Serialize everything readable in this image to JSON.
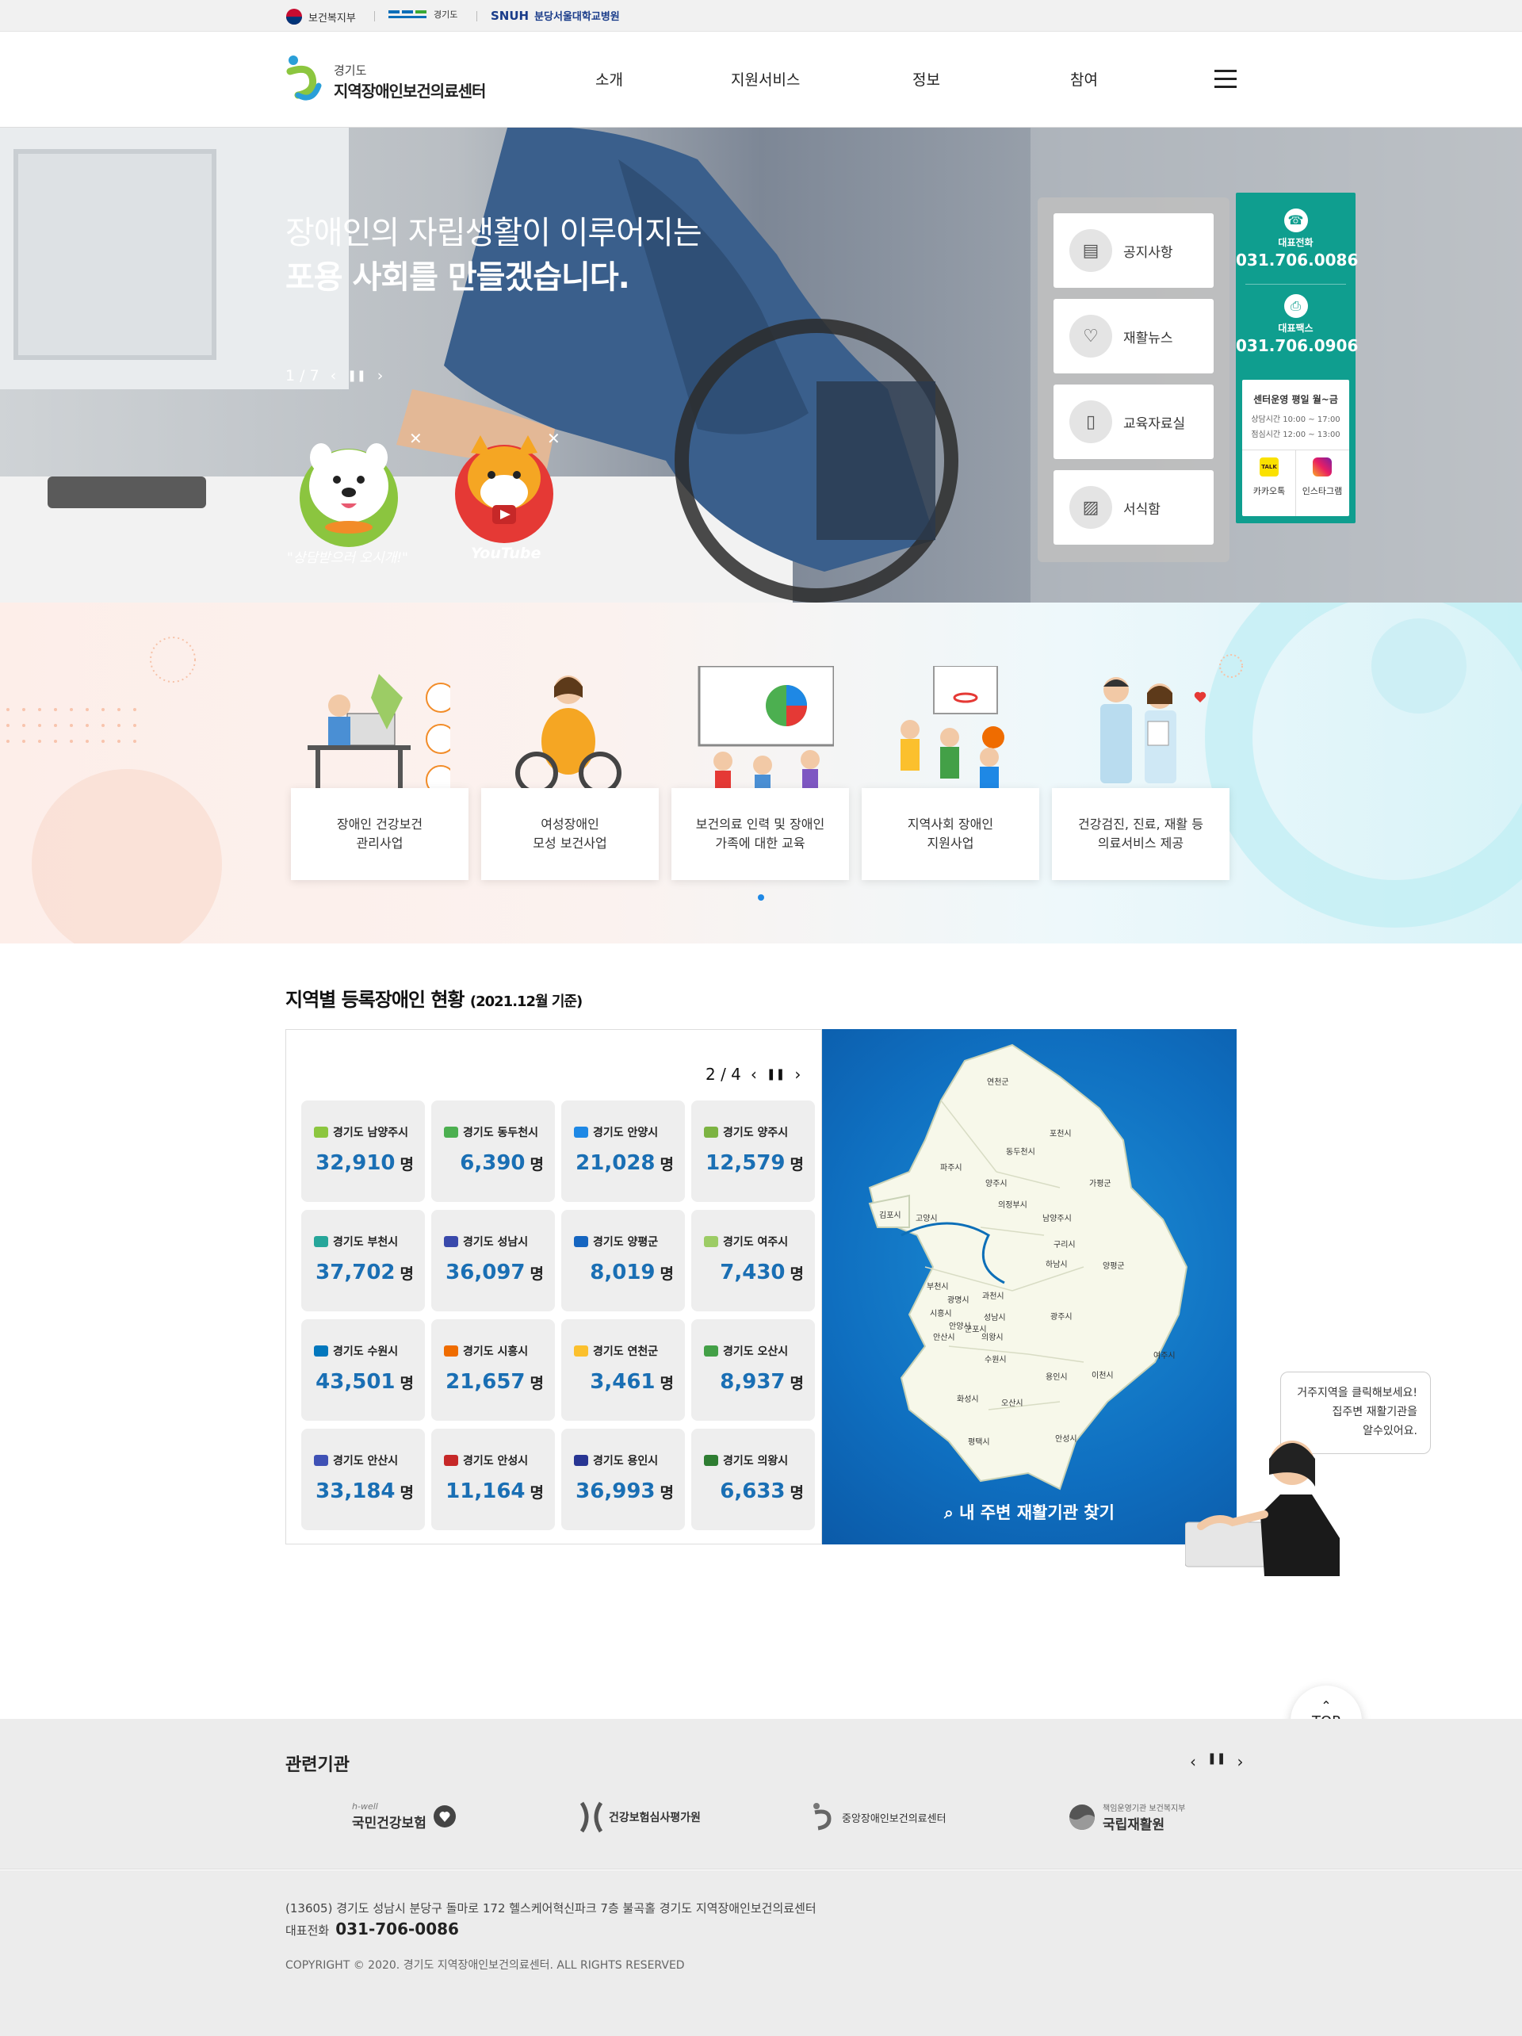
{
  "util": {
    "orgs": [
      "보건복지부",
      "경기도",
      "분당서울대학교병원"
    ],
    "snuh": "SNUH"
  },
  "header": {
    "logo_sub": "경기도",
    "logo_main": "지역장애인보건의료센터",
    "nav": [
      "소개",
      "지원서비스",
      "정보",
      "참여"
    ]
  },
  "hero": {
    "line1": "장애인의 자립생활이 이루어지는",
    "line2": "포용 사회를 만들겠습니다.",
    "pager": "1 / 7",
    "char1_caption": "\"상담받으러 오시개!\"",
    "char2_caption": "YouTube",
    "quick": [
      "공지사항",
      "재활뉴스",
      "교육자료실",
      "서식함"
    ],
    "contact": {
      "tel_label": "대표전화",
      "tel": "031.706.0086",
      "fax_label": "대표팩스",
      "fax": "031.706.0906",
      "hours_title": "센터운영 평일 월~금",
      "hours1": "상담시간 10:00 ~ 17:00",
      "hours2": "점심시간 12:00 ~ 13:00",
      "kakao": "카카오톡",
      "insta": "인스타그램",
      "talk": "TALK"
    }
  },
  "business": {
    "cards": [
      [
        "장애인 건강보건",
        "관리사업"
      ],
      [
        "여성장애인",
        "모성 보건사업"
      ],
      [
        "보건의료 인력 및 장애인",
        "가족에 대한 교육"
      ],
      [
        "지역사회 장애인",
        "지원사업"
      ],
      [
        "건강검진, 진료, 재활 등",
        "의료서비스 제공"
      ]
    ]
  },
  "region": {
    "title": "지역별 등록장애인 현황",
    "sub": "(2021.12월 기준)",
    "pager": "2 / 4",
    "unit": "명",
    "items": [
      {
        "name": "경기도 남양주시",
        "value": "32,910",
        "color": "#8cc63f"
      },
      {
        "name": "경기도 동두천시",
        "value": "6,390",
        "color": "#4caf50"
      },
      {
        "name": "경기도 안양시",
        "value": "21,028",
        "color": "#1e88e5"
      },
      {
        "name": "경기도 양주시",
        "value": "12,579",
        "color": "#7cb342"
      },
      {
        "name": "경기도 부천시",
        "value": "37,702",
        "color": "#26a69a"
      },
      {
        "name": "경기도 성남시",
        "value": "36,097",
        "color": "#3949ab"
      },
      {
        "name": "경기도 양평군",
        "value": "8,019",
        "color": "#1565c0"
      },
      {
        "name": "경기도 여주시",
        "value": "7,430",
        "color": "#9ccc65"
      },
      {
        "name": "경기도 수원시",
        "value": "43,501",
        "color": "#0277bd"
      },
      {
        "name": "경기도 시흥시",
        "value": "21,657",
        "color": "#ef6c00"
      },
      {
        "name": "경기도 연천군",
        "value": "3,461",
        "color": "#fbc02d"
      },
      {
        "name": "경기도 오산시",
        "value": "8,937",
        "color": "#43a047"
      },
      {
        "name": "경기도 안산시",
        "value": "33,184",
        "color": "#3f51b5"
      },
      {
        "name": "경기도 안성시",
        "value": "11,164",
        "color": "#c62828"
      },
      {
        "name": "경기도 용인시",
        "value": "36,993",
        "color": "#283593"
      },
      {
        "name": "경기도 의왕시",
        "value": "6,633",
        "color": "#2e7d32"
      }
    ],
    "map_labels": [
      "연천군",
      "포천시",
      "동두천시",
      "파주시",
      "양주시",
      "가평군",
      "의정부시",
      "김포시",
      "고양시",
      "남양주시",
      "구리시",
      "하남시",
      "양평군",
      "부천시",
      "광명시",
      "과천시",
      "시흥시",
      "안양시",
      "성남시",
      "광주시",
      "군포시",
      "의왕시",
      "안산시",
      "수원시",
      "여주시",
      "용인시",
      "이천시",
      "화성시",
      "오산시",
      "평택시",
      "안성시"
    ],
    "find_btn": "내 주변 재활기관 찾기",
    "bubble": [
      "거주지역을 클릭해보세요!",
      "집주변 재활기관을",
      "알수있어요."
    ]
  },
  "top_label": "TOP",
  "related": {
    "title": "관련기관",
    "orgs": [
      {
        "sub": "h-well",
        "name": "국민건강보험"
      },
      {
        "sub": "",
        "name": "건강보험심사평가원"
      },
      {
        "sub": "",
        "name": "중앙장애인보건의료센터"
      },
      {
        "sub": "책임운영기관 보건복지부",
        "name": "국립재활원"
      }
    ]
  },
  "footer": {
    "address": "(13605) 경기도 성남시 분당구 돌마로 172 헬스케어혁신파크 7층 불곡홀 경기도 지역장애인보건의료센터",
    "tel_label": "대표전화",
    "tel": "031-706-0086",
    "copyright": "COPYRIGHT © 2020. 경기도 지역장애인보건의료센터. ALL RIGHTS RESERVED"
  }
}
